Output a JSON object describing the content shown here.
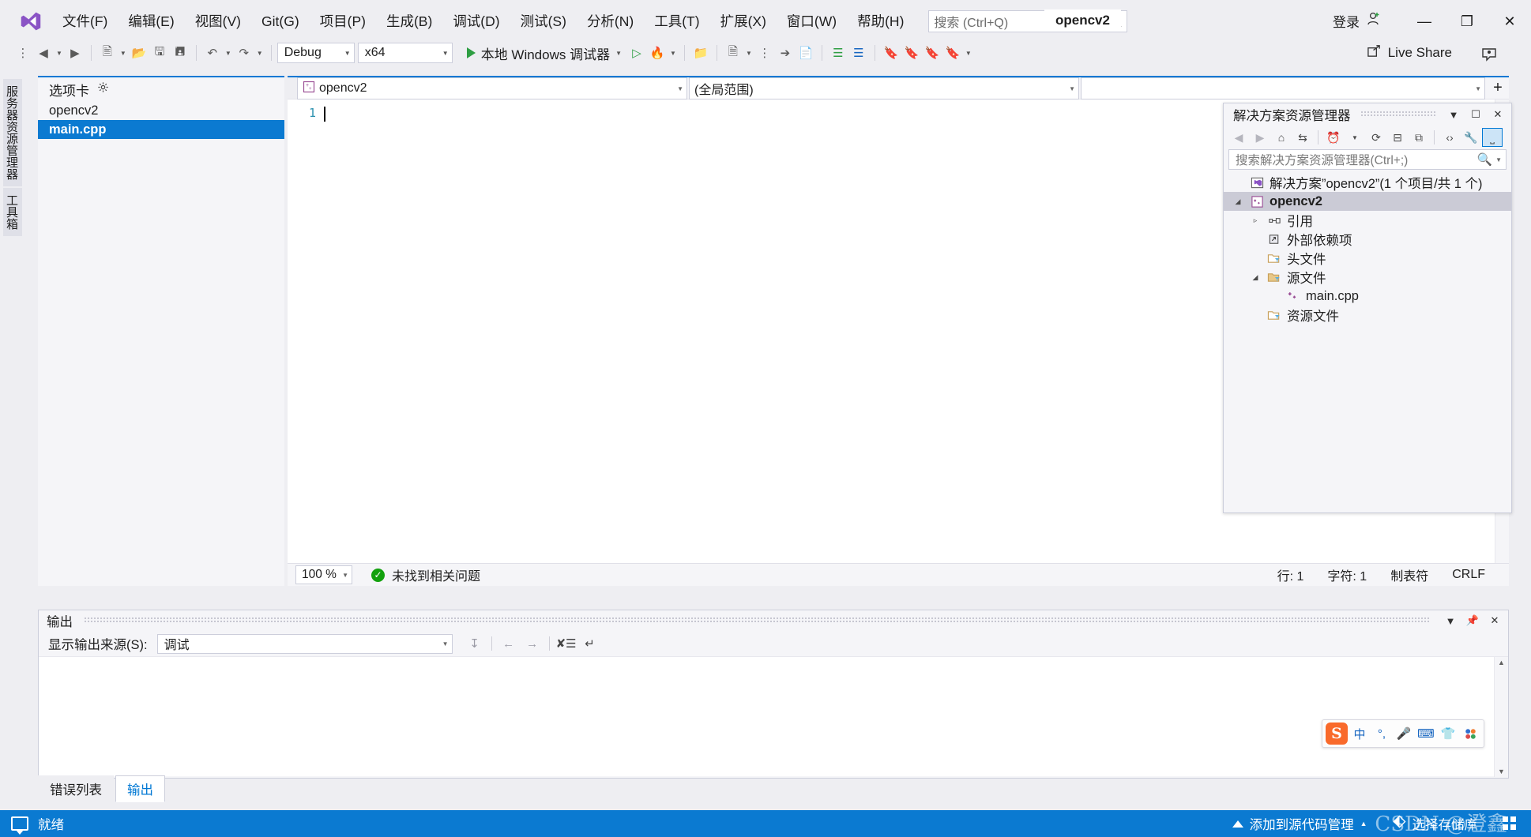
{
  "window": {
    "project_title": "opencv2",
    "signin_label": "登录",
    "minimize": "—",
    "restore": "❐",
    "close": "✕"
  },
  "menu": {
    "items": [
      {
        "text": "文件(F)",
        "name": "menu-file"
      },
      {
        "text": "编辑(E)",
        "name": "menu-edit"
      },
      {
        "text": "视图(V)",
        "name": "menu-view"
      },
      {
        "text": "Git(G)",
        "name": "menu-git"
      },
      {
        "text": "项目(P)",
        "name": "menu-project"
      },
      {
        "text": "生成(B)",
        "name": "menu-build"
      },
      {
        "text": "调试(D)",
        "name": "menu-debug"
      },
      {
        "text": "测试(S)",
        "name": "menu-test"
      },
      {
        "text": "分析(N)",
        "name": "menu-analyze"
      },
      {
        "text": "工具(T)",
        "name": "menu-tools"
      },
      {
        "text": "扩展(X)",
        "name": "menu-extensions"
      },
      {
        "text": "窗口(W)",
        "name": "menu-window"
      },
      {
        "text": "帮助(H)",
        "name": "menu-help"
      }
    ]
  },
  "search": {
    "placeholder": "搜索 (Ctrl+Q)",
    "icon": "search-icon"
  },
  "toolbar": {
    "config_value": "Debug",
    "platform_value": "x64",
    "run_label": "本地 Windows 调试器",
    "live_share_label": "Live Share"
  },
  "vertical_tabs": [
    {
      "label": "服务器资源管理器",
      "name": "vtab-server-explorer"
    },
    {
      "label": "工具箱",
      "name": "vtab-toolbox"
    }
  ],
  "left_panel": {
    "header": "选项卡",
    "items": [
      {
        "label": "opencv2",
        "selected": false
      },
      {
        "label": "main.cpp",
        "selected": true
      }
    ]
  },
  "editor": {
    "nav_project": "opencv2",
    "nav_scope": "(全局范围)",
    "nav_member": "",
    "line_numbers": [
      "1"
    ],
    "code_lines": [
      ""
    ],
    "zoom": "100 %",
    "status_message": "未找到相关问题",
    "status_ok_icon": "check-icon",
    "line_indicator": "行: 1",
    "char_indicator": "字符: 1",
    "tab_indicator": "制表符",
    "eol_indicator": "CRLF"
  },
  "solution_explorer": {
    "title": "解决方案资源管理器",
    "search_placeholder": "搜索解决方案资源管理器(Ctrl+;)",
    "toolbar_icons": [
      {
        "name": "back-icon",
        "glyph": "←",
        "dim": true
      },
      {
        "name": "forward-icon",
        "glyph": "→",
        "dim": true
      },
      {
        "name": "home-icon",
        "glyph": "⌂",
        "dim": false
      },
      {
        "name": "sync-with-active-document-icon",
        "glyph": "⇄",
        "dim": false
      },
      {
        "name": "pending-changes-filter-icon",
        "glyph": "◴",
        "dim": false
      },
      {
        "name": "filter-dropdown-icon",
        "glyph": "▾",
        "dim": false
      },
      {
        "name": "refresh-icon",
        "glyph": "⟳",
        "dim": false
      },
      {
        "name": "collapse-all-icon",
        "glyph": "⊟",
        "dim": false
      },
      {
        "name": "show-all-files-icon",
        "glyph": "⧉",
        "dim": false
      },
      {
        "name": "code-view-icon",
        "glyph": "‹›",
        "dim": false
      },
      {
        "name": "properties-wrench-icon",
        "glyph": "ὒ7",
        "dim": false
      },
      {
        "name": "preview-selected-items-icon",
        "glyph": "▭",
        "dim": false,
        "active": true
      }
    ],
    "tree": [
      {
        "depth": 0,
        "twisty": "",
        "icon": "solution-icon",
        "label": "解决方案”opencv2”(1 个项目/共 1 个)",
        "selected": false
      },
      {
        "depth": 0,
        "twisty": "◢",
        "icon": "cpp-project-icon",
        "label": "opencv2",
        "selected": true
      },
      {
        "depth": 1,
        "twisty": "▹",
        "icon": "references-icon",
        "label": "引用",
        "selected": false
      },
      {
        "depth": 1,
        "twisty": "",
        "icon": "external-dependencies-icon",
        "label": "外部依赖项",
        "selected": false
      },
      {
        "depth": 1,
        "twisty": "",
        "icon": "folder-filter-icon",
        "label": "头文件",
        "selected": false
      },
      {
        "depth": 1,
        "twisty": "◢",
        "icon": "folder-open-filter-icon",
        "label": "源文件",
        "selected": false
      },
      {
        "depth": 2,
        "twisty": "",
        "icon": "cpp-file-icon",
        "label": "main.cpp",
        "selected": false
      },
      {
        "depth": 1,
        "twisty": "",
        "icon": "folder-filter-icon",
        "label": "资源文件",
        "selected": false
      }
    ]
  },
  "output_panel": {
    "title": "输出",
    "source_label": "显示输出来源(S):",
    "source_value": "调试",
    "content": "",
    "toolbar_icons": [
      {
        "name": "jump-to-source-icon",
        "glyph": "⤓"
      },
      {
        "name": "find-previous-message-icon",
        "glyph": "←"
      },
      {
        "name": "find-next-message-icon",
        "glyph": "→"
      },
      {
        "name": "clear-all-icon",
        "glyph": "⨯"
      },
      {
        "name": "toggle-word-wrap-icon",
        "glyph": "↵"
      }
    ]
  },
  "bottom_tabs": [
    {
      "label": "错误列表",
      "active": false,
      "name": "tab-error-list"
    },
    {
      "label": "输出",
      "active": true,
      "name": "tab-output"
    }
  ],
  "statusbar": {
    "ready_label": "就绪",
    "add_to_source_control": "添加到源代码管理",
    "select_repository": "选择存储库",
    "watermark": "CSDN @澄鑫"
  },
  "ime": {
    "logo": "S",
    "buttons": [
      {
        "name": "ime-chinese-mode-icon",
        "glyph": "中"
      },
      {
        "name": "ime-punctuation-icon",
        "glyph": "°,"
      },
      {
        "name": "ime-voice-input-icon",
        "glyph": "Ἲ4"
      },
      {
        "name": "ime-soft-keyboard-icon",
        "glyph": "⌨"
      },
      {
        "name": "ime-skin-icon",
        "glyph": "ὅ5"
      },
      {
        "name": "ime-toolbox-icon",
        "glyph": "∷"
      }
    ]
  },
  "colors": {
    "accent": "#0b7ad1",
    "chrome": "#eeeef2",
    "panel": "#f5f5f8",
    "selection": "#cbcbd6",
    "ok_green": "#13a10e",
    "cpp_purple": "#9b4f96"
  }
}
